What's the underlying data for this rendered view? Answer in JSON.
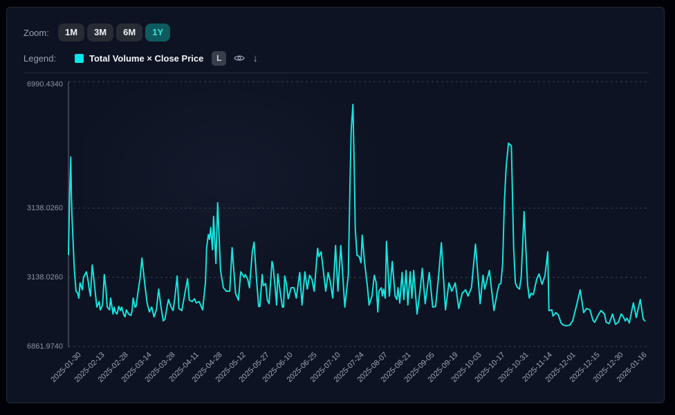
{
  "zoom_bar": {
    "label": "Zoom:",
    "buttons": [
      {
        "label": "1M",
        "active": false
      },
      {
        "label": "3M",
        "active": false
      },
      {
        "label": "6M",
        "active": false
      },
      {
        "label": "1Y",
        "active": true
      }
    ],
    "active_color": "#0f5a5e",
    "active_text_color": "#38e2da"
  },
  "legend": {
    "label": "Legend:",
    "series": {
      "name": "Total Volume × Close Price",
      "swatch_color": "#06e7ec"
    },
    "badge_label": "L",
    "icons": [
      "eye",
      "arrow-down"
    ]
  },
  "chart_data": {
    "type": "line",
    "title": "",
    "xlabel": "",
    "ylabel": "",
    "grid": "dashed horizontal gridlines, solid left axis",
    "legend_position": "header row top-left",
    "y_tick_labels": [
      "6990.4340",
      "3138.0260",
      "3138.0260",
      "6861.9740"
    ],
    "y_tick_values_est": [
      46990.434,
      33138.026,
      23138.026,
      16861.974
    ],
    "x_tick_labels": [
      "2025-01-30",
      "2025-02-13",
      "2025-02-28",
      "2025-03-14",
      "2025-03-28",
      "2025-04-11",
      "2025-04-28",
      "2025-05-12",
      "2025-05-27",
      "2025-06-10",
      "2025-06-25",
      "2025-07-10",
      "2025-07-24",
      "2025-08-07",
      "2025-08-21",
      "2025-09-05",
      "2025-09-19",
      "2025-10-03",
      "2025-10-17",
      "2025-10-31",
      "2025-11-14",
      "2025-12-01",
      "2025-12-15",
      "2025-12-30",
      "2026-01-16"
    ],
    "series": [
      {
        "name": "Total Volume × Close Price",
        "color": "#17e3e0",
        "x_unit": "permille of x-range (2025-01 to 2026-01)",
        "points": [
          [
            0,
            26438
          ],
          [
            2,
            34652
          ],
          [
            4,
            38740
          ],
          [
            5,
            34652
          ],
          [
            6,
            32138
          ],
          [
            10,
            24438
          ],
          [
            13,
            21883
          ],
          [
            16,
            21694
          ],
          [
            18,
            21255
          ],
          [
            20,
            22636
          ],
          [
            24,
            22008
          ],
          [
            26,
            23138
          ],
          [
            31,
            23938
          ],
          [
            34,
            22824
          ],
          [
            36,
            22008
          ],
          [
            38,
            21443
          ],
          [
            41,
            24938
          ],
          [
            43,
            23638
          ],
          [
            47,
            21443
          ],
          [
            49,
            20439
          ],
          [
            53,
            20941
          ],
          [
            55,
            20188
          ],
          [
            59,
            20628
          ],
          [
            62,
            23538
          ],
          [
            65,
            22008
          ],
          [
            67,
            20439
          ],
          [
            71,
            20188
          ],
          [
            73,
            21255
          ],
          [
            77,
            19812
          ],
          [
            79,
            20439
          ],
          [
            81,
            20000
          ],
          [
            84,
            19812
          ],
          [
            87,
            20502
          ],
          [
            90,
            20125
          ],
          [
            92,
            20439
          ],
          [
            96,
            19686
          ],
          [
            98,
            19561
          ],
          [
            100,
            20188
          ],
          [
            104,
            19812
          ],
          [
            108,
            19686
          ],
          [
            110,
            20125
          ],
          [
            112,
            21255
          ],
          [
            115,
            20439
          ],
          [
            117,
            20502
          ],
          [
            120,
            21694
          ],
          [
            124,
            23138
          ],
          [
            127,
            25938
          ],
          [
            132,
            22510
          ],
          [
            136,
            20816
          ],
          [
            140,
            20000
          ],
          [
            144,
            20439
          ],
          [
            148,
            19561
          ],
          [
            152,
            20188
          ],
          [
            156,
            22071
          ],
          [
            160,
            20439
          ],
          [
            164,
            19184
          ],
          [
            167,
            19372
          ],
          [
            170,
            20314
          ],
          [
            173,
            21130
          ],
          [
            177,
            20502
          ],
          [
            181,
            20125
          ],
          [
            184,
            21255
          ],
          [
            188,
            23338
          ],
          [
            191,
            20314
          ],
          [
            196,
            20125
          ],
          [
            201,
            21569
          ],
          [
            206,
            23013
          ],
          [
            209,
            21067
          ],
          [
            214,
            20941
          ],
          [
            218,
            21192
          ],
          [
            221,
            20816
          ],
          [
            226,
            20941
          ],
          [
            232,
            20188
          ],
          [
            237,
            22699
          ],
          [
            239,
            27438
          ],
          [
            242,
            29338
          ],
          [
            244,
            28638
          ],
          [
            246,
            30338
          ],
          [
            249,
            27138
          ],
          [
            251,
            31938
          ],
          [
            255,
            25138
          ],
          [
            258,
            33744
          ],
          [
            263,
            24138
          ],
          [
            268,
            22196
          ],
          [
            273,
            21883
          ],
          [
            279,
            21883
          ],
          [
            283,
            27438
          ],
          [
            289,
            21694
          ],
          [
            294,
            21067
          ],
          [
            298,
            23938
          ],
          [
            304,
            23138
          ],
          [
            306,
            23538
          ],
          [
            310,
            22950
          ],
          [
            313,
            22196
          ],
          [
            318,
            26838
          ],
          [
            321,
            28238
          ],
          [
            325,
            23138
          ],
          [
            329,
            20502
          ],
          [
            331,
            20502
          ],
          [
            335,
            23538
          ],
          [
            337,
            22385
          ],
          [
            341,
            22573
          ],
          [
            344,
            21067
          ],
          [
            347,
            20753
          ],
          [
            352,
            25438
          ],
          [
            354,
            24838
          ],
          [
            358,
            21883
          ],
          [
            360,
            20628
          ],
          [
            362,
            23638
          ],
          [
            366,
            21883
          ],
          [
            370,
            20439
          ],
          [
            372,
            20439
          ],
          [
            374,
            23338
          ],
          [
            377,
            22510
          ],
          [
            380,
            21192
          ],
          [
            385,
            22196
          ],
          [
            390,
            22196
          ],
          [
            394,
            21255
          ],
          [
            400,
            23838
          ],
          [
            404,
            20628
          ],
          [
            409,
            23938
          ],
          [
            413,
            22071
          ],
          [
            417,
            23438
          ],
          [
            421,
            22950
          ],
          [
            425,
            21883
          ],
          [
            431,
            27338
          ],
          [
            433,
            26138
          ],
          [
            437,
            26838
          ],
          [
            445,
            21883
          ],
          [
            449,
            23838
          ],
          [
            453,
            22699
          ],
          [
            457,
            21255
          ],
          [
            462,
            27738
          ],
          [
            466,
            21883
          ],
          [
            471,
            27738
          ],
          [
            478,
            20439
          ],
          [
            484,
            23438
          ],
          [
            487,
            35939
          ],
          [
            489,
            41692
          ],
          [
            492,
            44492
          ],
          [
            494,
            38437
          ],
          [
            496,
            30138
          ],
          [
            499,
            26338
          ],
          [
            503,
            26138
          ],
          [
            506,
            25238
          ],
          [
            508,
            29238
          ],
          [
            512,
            25438
          ],
          [
            517,
            22322
          ],
          [
            520,
            20628
          ],
          [
            525,
            21443
          ],
          [
            529,
            23438
          ],
          [
            532,
            22699
          ],
          [
            535,
            20000
          ],
          [
            537,
            21883
          ],
          [
            541,
            22196
          ],
          [
            543,
            21443
          ],
          [
            545,
            22071
          ],
          [
            548,
            21255
          ],
          [
            550,
            28338
          ],
          [
            555,
            21443
          ],
          [
            560,
            25438
          ],
          [
            565,
            21443
          ],
          [
            568,
            21130
          ],
          [
            570,
            22196
          ],
          [
            573,
            20816
          ],
          [
            577,
            23838
          ],
          [
            580,
            21130
          ],
          [
            584,
            24138
          ],
          [
            587,
            20628
          ],
          [
            591,
            23938
          ],
          [
            594,
            21255
          ],
          [
            597,
            24138
          ],
          [
            603,
            19812
          ],
          [
            608,
            21883
          ],
          [
            612,
            24438
          ],
          [
            617,
            20753
          ],
          [
            624,
            23838
          ],
          [
            630,
            20439
          ],
          [
            635,
            20502
          ],
          [
            640,
            23138
          ],
          [
            645,
            28138
          ],
          [
            652,
            20188
          ],
          [
            658,
            22636
          ],
          [
            663,
            21883
          ],
          [
            669,
            22636
          ],
          [
            675,
            20314
          ],
          [
            681,
            21694
          ],
          [
            687,
            22008
          ],
          [
            691,
            21443
          ],
          [
            697,
            22196
          ],
          [
            704,
            27938
          ],
          [
            712,
            20753
          ],
          [
            717,
            23438
          ],
          [
            720,
            22071
          ],
          [
            728,
            24138
          ],
          [
            736,
            20125
          ],
          [
            742,
            21883
          ],
          [
            745,
            22510
          ],
          [
            748,
            22573
          ],
          [
            751,
            25138
          ],
          [
            754,
            33895
          ],
          [
            757,
            37680
          ],
          [
            761,
            40254
          ],
          [
            766,
            39951
          ],
          [
            770,
            27438
          ],
          [
            773,
            22636
          ],
          [
            776,
            22259
          ],
          [
            780,
            22071
          ],
          [
            783,
            23138
          ],
          [
            788,
            32638
          ],
          [
            794,
            22510
          ],
          [
            797,
            21255
          ],
          [
            800,
            21694
          ],
          [
            804,
            21569
          ],
          [
            810,
            23013
          ],
          [
            814,
            23638
          ],
          [
            819,
            22510
          ],
          [
            824,
            23338
          ],
          [
            829,
            26838
          ],
          [
            831,
            20125
          ],
          [
            836,
            20188
          ],
          [
            838,
            19623
          ],
          [
            843,
            19937
          ],
          [
            847,
            19749
          ],
          [
            852,
            18996
          ],
          [
            856,
            18808
          ],
          [
            861,
            18745
          ],
          [
            867,
            18808
          ],
          [
            872,
            19184
          ],
          [
            879,
            20628
          ],
          [
            885,
            22008
          ],
          [
            891,
            19937
          ],
          [
            896,
            20314
          ],
          [
            902,
            20188
          ],
          [
            907,
            19247
          ],
          [
            910,
            19059
          ],
          [
            916,
            19686
          ],
          [
            921,
            20125
          ],
          [
            927,
            19812
          ],
          [
            930,
            19059
          ],
          [
            935,
            18933
          ],
          [
            941,
            19812
          ],
          [
            946,
            18871
          ],
          [
            951,
            19059
          ],
          [
            956,
            19812
          ],
          [
            959,
            19623
          ],
          [
            963,
            19184
          ],
          [
            966,
            19435
          ],
          [
            970,
            18996
          ],
          [
            977,
            20816
          ],
          [
            982,
            19498
          ],
          [
            989,
            21130
          ],
          [
            994,
            19372
          ],
          [
            997,
            19184
          ]
        ]
      }
    ]
  }
}
